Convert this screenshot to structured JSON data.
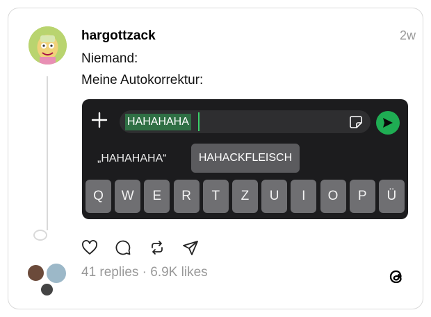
{
  "post": {
    "username": "hargottzack",
    "timestamp": "2w",
    "lines": [
      "Niemand:",
      "Meine Autokorrektur:"
    ]
  },
  "keyboard": {
    "typed_text": "HAHAHAHA",
    "suggestions": [
      "„HAHAHAHA“",
      "HAHACKFLEISCH"
    ],
    "keys": [
      "Q",
      "W",
      "E",
      "R",
      "T",
      "Z",
      "U",
      "I",
      "O",
      "P",
      "Ü"
    ]
  },
  "footer": {
    "stats": "41 replies · 6.9K likes"
  },
  "icons": {
    "like": "heart-icon",
    "reply": "comment-icon",
    "repost": "repost-icon",
    "share": "send-icon",
    "brand": "threads-logo"
  },
  "colors": {
    "send_button": "#1fad53",
    "highlight": "#2f6f44",
    "muted_text": "#999999"
  }
}
